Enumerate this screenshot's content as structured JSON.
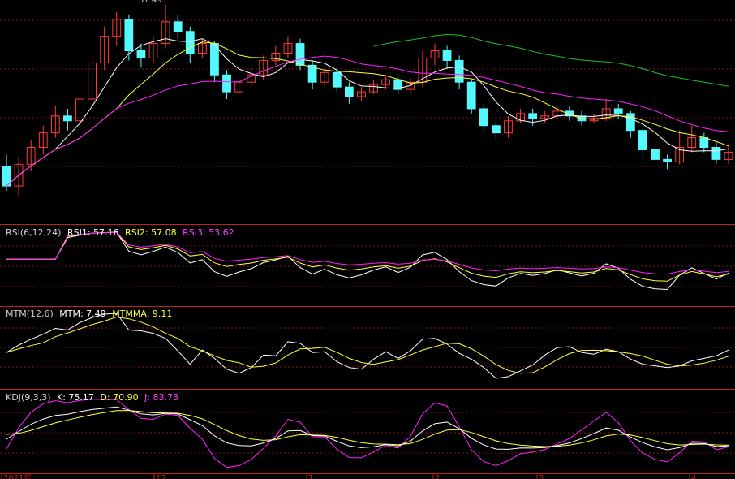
{
  "colors": {
    "background": "#000000",
    "divider": "#c02020",
    "grid": "#7a1818",
    "candle_up": "#ff3b3b",
    "candle_down": "#54f8ff",
    "ma_white": "#ffffff",
    "ma_yellow": "#ffff40",
    "ma_magenta": "#ff20ff",
    "ma_green": "#20c020",
    "label_white": "#d0d0d0"
  },
  "price_panel": {
    "peak_price_label": "57.49"
  },
  "rsi_panel": {
    "name": "RSI(6,12,24)",
    "rsi1": "RSI1: 57.16",
    "rsi2": "RSI2: 57.08",
    "rsi3": "RSI3: 53.62"
  },
  "mtm_panel": {
    "name": "MTM(12,6)",
    "mtm": "MTM: 7.49",
    "mtmma": "MTMMA: 9.11"
  },
  "kdj_panel": {
    "name": "KDJ(9,3,3)",
    "k": "K: 75.17",
    "d": "D: 70.90",
    "j": "J: 83.73"
  },
  "x_axis": {
    "labels": [
      "2021年",
      "12",
      "1",
      "2",
      "3",
      "4"
    ]
  },
  "chart_data": {
    "type": "candlestick",
    "candles": [
      [
        50.8,
        50.0,
        51.3,
        49.8
      ],
      [
        50.0,
        50.9,
        51.2,
        49.6
      ],
      [
        50.9,
        51.6,
        51.9,
        50.6
      ],
      [
        51.6,
        52.2,
        52.5,
        51.3
      ],
      [
        52.2,
        52.9,
        53.3,
        52.0
      ],
      [
        52.9,
        52.7,
        53.2,
        52.3
      ],
      [
        52.7,
        53.6,
        53.9,
        52.5
      ],
      [
        53.6,
        55.1,
        55.4,
        53.4
      ],
      [
        55.1,
        56.2,
        56.6,
        54.8
      ],
      [
        56.2,
        56.9,
        57.2,
        55.8
      ],
      [
        56.9,
        55.6,
        57.1,
        55.2
      ],
      [
        55.6,
        55.3,
        55.9,
        54.9
      ],
      [
        55.3,
        55.9,
        56.2,
        55.1
      ],
      [
        55.9,
        56.8,
        57.5,
        55.7
      ],
      [
        56.8,
        56.4,
        57.1,
        56.1
      ],
      [
        56.4,
        55.5,
        56.6,
        55.1
      ],
      [
        55.5,
        55.9,
        56.1,
        55.3
      ],
      [
        55.9,
        54.6,
        56.0,
        54.3
      ],
      [
        54.6,
        53.9,
        54.8,
        53.6
      ],
      [
        53.9,
        54.3,
        54.6,
        53.7
      ],
      [
        54.3,
        54.6,
        54.9,
        54.1
      ],
      [
        54.6,
        55.2,
        55.4,
        54.4
      ],
      [
        55.2,
        55.5,
        55.8,
        55.0
      ],
      [
        55.5,
        55.9,
        56.2,
        55.3
      ],
      [
        55.9,
        55.0,
        56.1,
        54.8
      ],
      [
        55.0,
        54.3,
        55.2,
        54.0
      ],
      [
        54.3,
        54.7,
        54.9,
        54.1
      ],
      [
        54.7,
        54.1,
        54.9,
        53.9
      ],
      [
        54.1,
        53.7,
        54.3,
        53.4
      ],
      [
        53.7,
        53.9,
        54.1,
        53.5
      ],
      [
        53.9,
        54.2,
        54.4,
        53.8
      ],
      [
        54.2,
        54.4,
        54.6,
        54.0
      ],
      [
        54.4,
        54.0,
        54.6,
        53.8
      ],
      [
        54.0,
        54.3,
        54.5,
        53.8
      ],
      [
        54.3,
        55.3,
        55.6,
        54.1
      ],
      [
        55.3,
        55.6,
        55.9,
        55.0
      ],
      [
        55.6,
        55.2,
        55.8,
        54.9
      ],
      [
        55.2,
        54.3,
        55.4,
        54.0
      ],
      [
        54.3,
        53.2,
        54.4,
        53.0
      ],
      [
        53.2,
        52.5,
        53.4,
        52.3
      ],
      [
        52.5,
        52.2,
        52.7,
        51.9
      ],
      [
        52.2,
        52.7,
        52.9,
        52.0
      ],
      [
        52.7,
        53.0,
        53.2,
        52.6
      ],
      [
        53.0,
        52.8,
        53.2,
        52.5
      ],
      [
        52.8,
        52.9,
        53.1,
        52.6
      ],
      [
        52.9,
        53.1,
        53.3,
        52.8
      ],
      [
        53.1,
        52.9,
        53.3,
        52.7
      ],
      [
        52.9,
        52.7,
        53.1,
        52.5
      ],
      [
        52.7,
        52.8,
        53.0,
        52.6
      ],
      [
        52.8,
        53.2,
        53.6,
        52.7
      ],
      [
        53.2,
        53.0,
        53.4,
        52.8
      ],
      [
        53.0,
        52.3,
        53.1,
        52.0
      ],
      [
        52.3,
        51.5,
        52.5,
        51.2
      ],
      [
        51.5,
        51.1,
        51.7,
        50.8
      ],
      [
        51.1,
        51.0,
        51.3,
        50.7
      ],
      [
        51.0,
        51.6,
        52.3,
        50.9
      ],
      [
        51.6,
        52.0,
        52.5,
        51.4
      ],
      [
        52.0,
        51.6,
        52.2,
        51.4
      ],
      [
        51.6,
        51.1,
        51.8,
        50.9
      ],
      [
        51.1,
        51.4,
        51.7,
        50.9
      ]
    ],
    "indicators": [
      "RSI(6,12,24)",
      "MTM(12,6)",
      "KDJ(9,3,3)"
    ]
  }
}
